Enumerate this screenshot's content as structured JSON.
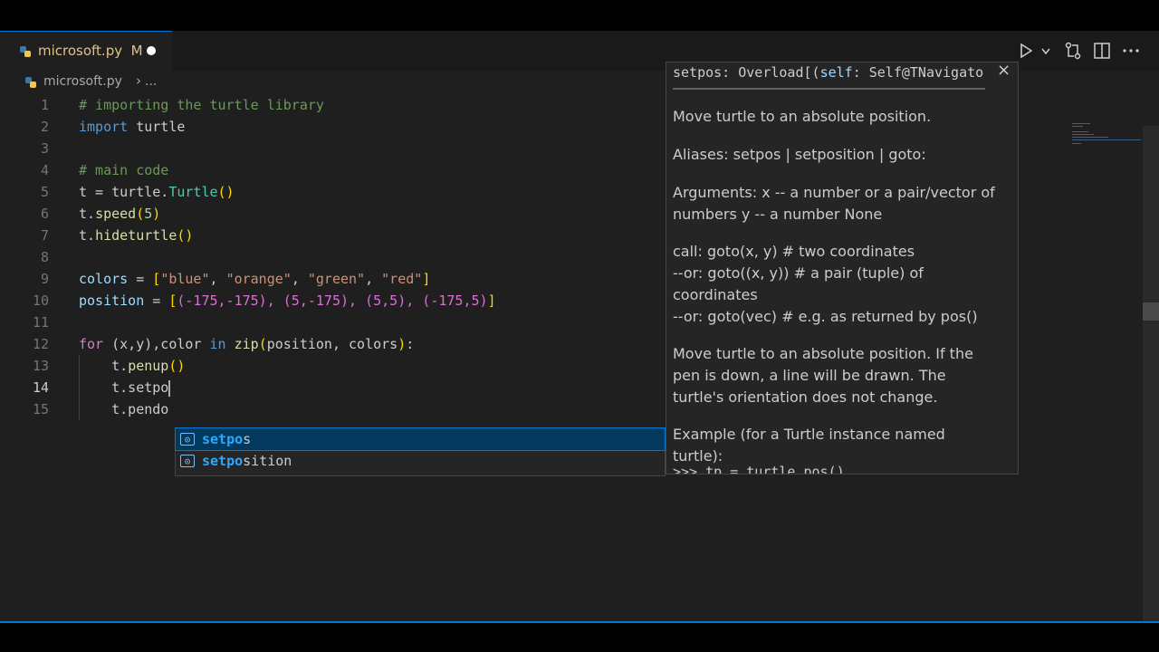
{
  "tab": {
    "file": "microsoft.py",
    "modified": "M"
  },
  "breadcrumb": {
    "file": "microsoft.py",
    "separator": "›",
    "more": "..."
  },
  "editor_lines": [
    "1",
    "2",
    "3",
    "4",
    "5",
    "6",
    "7",
    "8",
    "9",
    "10",
    "11",
    "12",
    "13",
    "14",
    "15"
  ],
  "code": {
    "l1": "# importing the turtle library",
    "l2_kw": "import",
    "l2_mod": "turtle",
    "l4": "# main code",
    "l5_a": "t = turtle.",
    "l5_cls": "Turtle",
    "l5_b": "()",
    "l6_a": "t.",
    "l6_fn": "speed",
    "l6_n": "5",
    "l7_a": "t.",
    "l7_fn": "hideturtle",
    "l9_var": "colors",
    "l9_s1": "\"blue\"",
    "l9_s2": "\"orange\"",
    "l9_s3": "\"green\"",
    "l9_s4": "\"red\"",
    "l10_var": "position",
    "l10_vals": "(-175,-175), (5,-175), (5,5), (-175,5)",
    "l12_for": "for",
    "l12_a": "(x,y),color",
    "l12_in": "in",
    "l12_fn": "zip",
    "l12_args": "position, colors",
    "l13_a": "t.",
    "l13_fn": "penup",
    "l14_a": "t.setpo",
    "l15_a": "t.pendo"
  },
  "suggest": {
    "items": [
      {
        "match": "setpo",
        "rest": "s",
        "icon": "[⊘]"
      },
      {
        "match": "setpo",
        "rest": "sition",
        "icon": "[⊘]"
      }
    ]
  },
  "docs": {
    "signature_name": "setpos: Overload[(",
    "signature_self": "self",
    "signature_rest": ": Self@TNavigator",
    "close": "×",
    "p1": "Move turtle to an absolute position.",
    "p2": "Aliases: setpos | setposition | goto:",
    "p3": "Arguments: x -- a number or a pair/vector of numbers y -- a number None",
    "p4a": "call: goto(x, y) # two coordinates",
    "p4b": "--or: goto((x, y)) # a pair (tuple) of coordinates",
    "p4c": "--or: goto(vec) # e.g. as returned by pos()",
    "p5": "Move turtle to an absolute position. If the pen is down, a line will be drawn. The turtle's orientation does not change.",
    "p6": "Example (for a Turtle instance named turtle):",
    "p7": ">>> tp = turtle.pos()"
  },
  "colors": {
    "accent": "#0078d4",
    "modified": "#e2c08d",
    "comment": "#6a9955"
  }
}
